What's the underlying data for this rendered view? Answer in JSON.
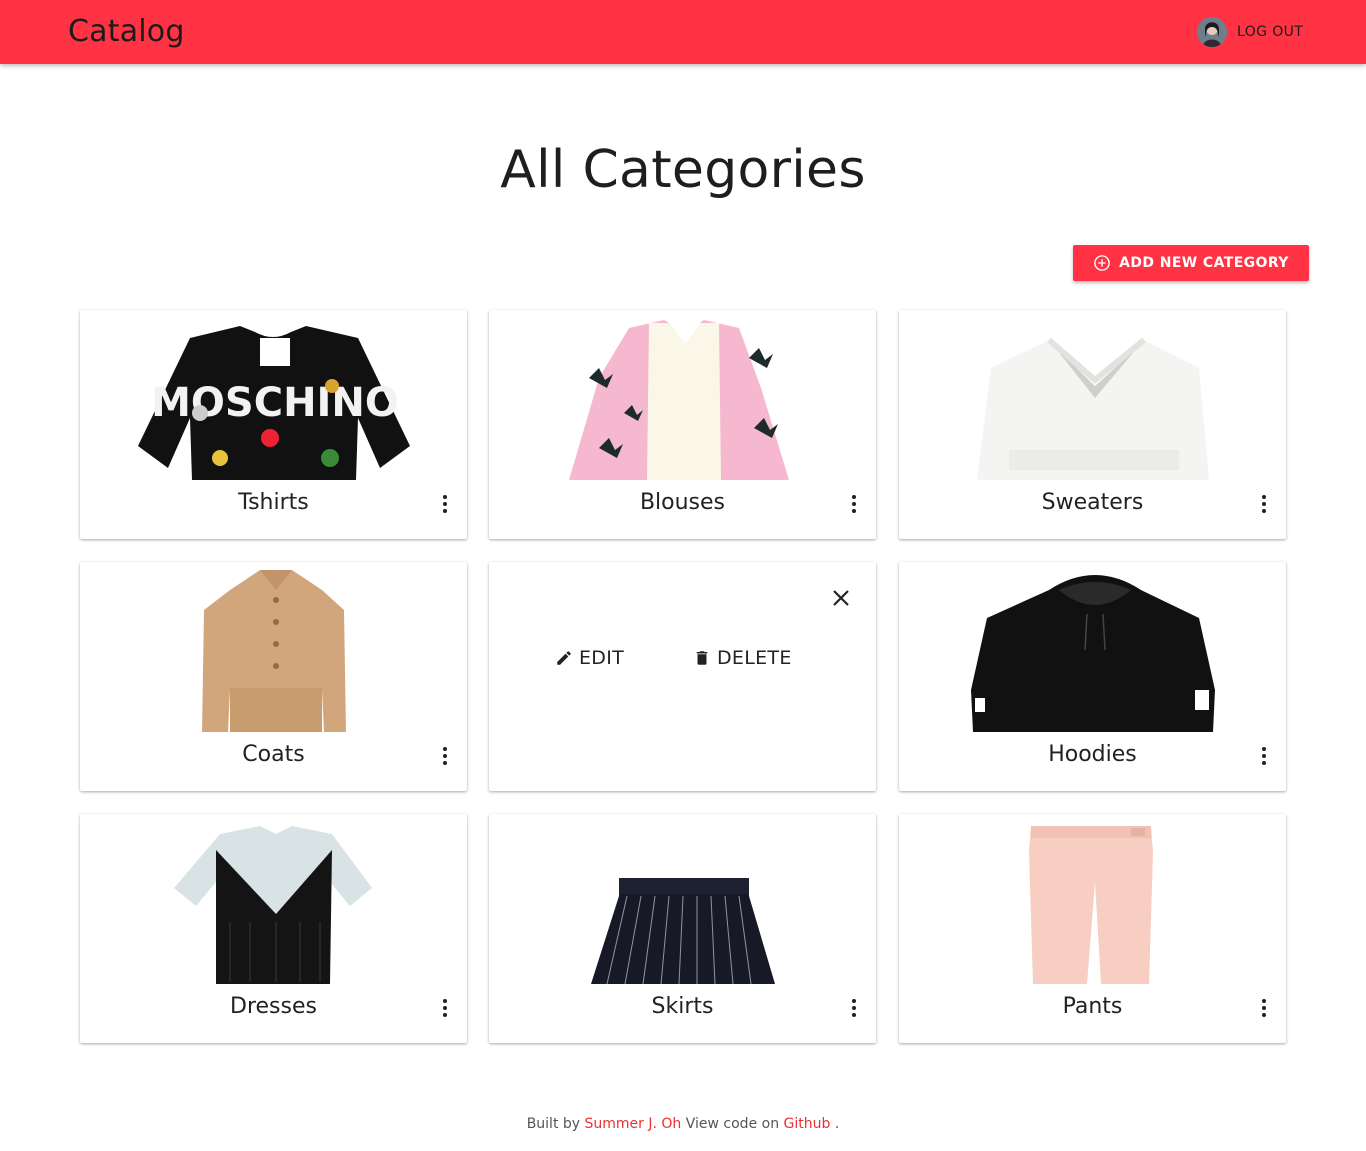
{
  "appbar": {
    "title": "Catalog",
    "logout_label": "LOG OUT",
    "color": "#ff3344"
  },
  "page": {
    "title": "All Categories",
    "add_button_label": "ADD NEW CATEGORY"
  },
  "categories": [
    {
      "label": "Tshirts",
      "icon": "tshirt-image"
    },
    {
      "label": "Blouses",
      "icon": "blouse-image"
    },
    {
      "label": "Sweaters",
      "icon": "sweater-image"
    },
    {
      "label": "Coats",
      "icon": "coat-image"
    },
    {
      "label": "",
      "menu_open": true,
      "edit_label": "EDIT",
      "delete_label": "DELETE"
    },
    {
      "label": "Hoodies",
      "icon": "hoodie-image"
    },
    {
      "label": "Dresses",
      "icon": "dress-image"
    },
    {
      "label": "Skirts",
      "icon": "skirt-image"
    },
    {
      "label": "Pants",
      "icon": "pants-image"
    }
  ],
  "footer": {
    "built_by": "Built by",
    "author": "Summer J. Oh",
    "view_code": "View code on",
    "github": "Github",
    "end": "."
  }
}
